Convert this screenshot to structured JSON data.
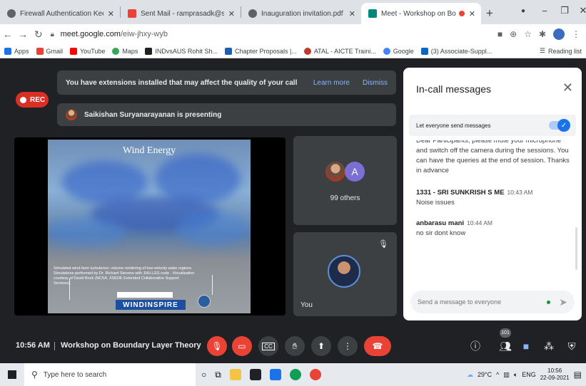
{
  "browser": {
    "tabs": [
      {
        "title": "Firewall Authentication Keepalive",
        "color": "#5f6368",
        "active": false
      },
      {
        "title": "Sent Mail - ramprasadk@svce.ac",
        "color": "#ea4335",
        "active": false
      },
      {
        "title": "Inauguration invitation.pdf",
        "color": "#5f6368",
        "active": false
      },
      {
        "title": "Meet - Workshop on Bounda",
        "color": "#00897b",
        "active": true
      }
    ],
    "url_host": "meet.google.com",
    "url_path": "/eiw-jhxy-wyb",
    "bookmarks": [
      {
        "label": "Apps",
        "color": "#1a73e8"
      },
      {
        "label": "Gmail",
        "color": "#ea4335"
      },
      {
        "label": "YouTube",
        "color": "#ff0000"
      },
      {
        "label": "Maps",
        "color": "#34a853"
      },
      {
        "label": "INDvsAUS Rohit Sh...",
        "color": "#202124"
      },
      {
        "label": "Chapter Proposals |...",
        "color": "#1a5fb4"
      },
      {
        "label": "ATAL - AICTE Traini...",
        "color": "#c0392b"
      },
      {
        "label": "Google",
        "color": "#4285f4"
      },
      {
        "label": "(3) Associate-Suppl...",
        "color": "#0a66c2"
      }
    ],
    "reading_list": "Reading list"
  },
  "meet": {
    "rec_label": "REC",
    "extension_banner": {
      "text": "You have extensions installed that may affect the quality of your call",
      "learn_more": "Learn more",
      "dismiss": "Dismiss"
    },
    "presenting_text": "Saikishan Suryanarayanan is presenting",
    "slide": {
      "title": "Wind Energy",
      "caption": "Simulated wind-farm turbulence: volume rendering of low-velocity wake regions. Simulations performed by Dr. Richard Stevens with JHU-LES code . Visualization courtesy of David Bock (NCSA, XSEDE Extended Collaborative Support Services).",
      "logo": "WINDINSPIRE"
    },
    "others_tile": {
      "initial": "A",
      "label": "99 others"
    },
    "you_tile": {
      "label": "You"
    },
    "clock": "10:56 AM",
    "meeting_name": "Workshop on Boundary Layer Theory",
    "participant_count": "101"
  },
  "chat": {
    "title": "In-call messages",
    "let_everyone": "Let everyone send messages",
    "messages": [
      {
        "sender": "",
        "time": "",
        "text": "Dear Participants, please mute your microphone and switch off the camera during the sessions. You can have the queries at the end of session. Thanks in advance"
      },
      {
        "sender": "1331 - SRI SUNKRISH S ME",
        "time": "10:43 AM",
        "text": "Noise issues"
      },
      {
        "sender": "anbarasu mani",
        "time": "10:44 AM",
        "text": "no sir dont know"
      }
    ],
    "input_placeholder": "Send a message to everyone"
  },
  "taskbar": {
    "search_placeholder": "Type here to search",
    "weather": "29°C",
    "lang": "ENG",
    "time": "10:56",
    "date": "22-09-2021"
  }
}
